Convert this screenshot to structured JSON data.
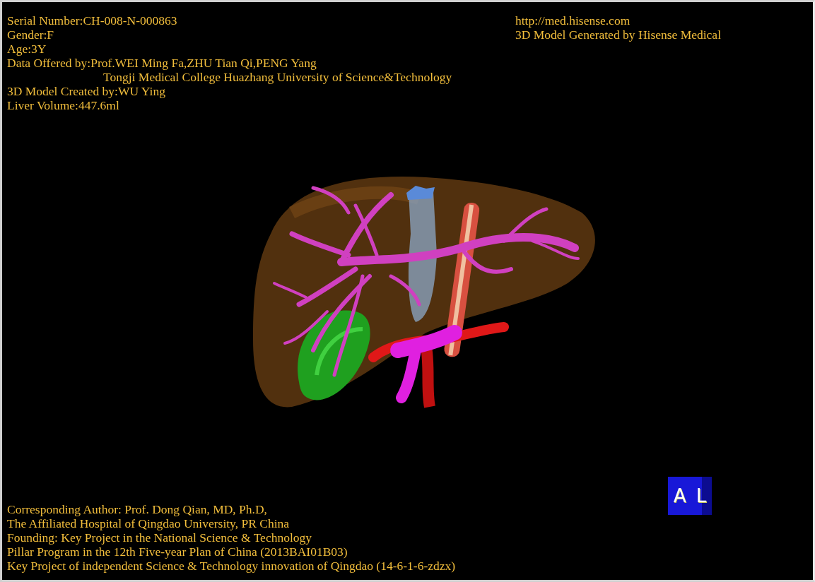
{
  "header_left": [
    {
      "kind": "line",
      "text": "Serial Number:CH-008-N-000863"
    },
    {
      "kind": "line",
      "text": "Gender:F"
    },
    {
      "kind": "line",
      "text": "Age:3Y"
    },
    {
      "kind": "line",
      "text": "Data Offered by:Prof.WEI Ming Fa,ZHU Tian Qi,PENG Yang"
    },
    {
      "kind": "continuation",
      "text": "Tongji Medical College Huazhang University of Science&Technology"
    },
    {
      "kind": "line",
      "text": "3D Model Created by:WU Ying"
    },
    {
      "kind": "line",
      "text": "Liver Volume:447.6ml"
    }
  ],
  "header_right": [
    "http://med.hisense.com",
    "3D Model Generated by Hisense Medical"
  ],
  "footer_left": [
    "Corresponding Author: Prof. Dong Qian, MD, Ph.D,",
    "The Affiliated Hospital of Qingdao University, PR China",
    "Founding: Key Project in the National Science & Technology",
    "Pillar Program in the 12th Five-year Plan of China (2013BAI01B03)",
    "Key Project of independent Science & Technology innovation of Qingdao (14-6-1-6-zdzx)"
  ],
  "orientation_cube": {
    "labels": [
      "A",
      "L"
    ]
  }
}
